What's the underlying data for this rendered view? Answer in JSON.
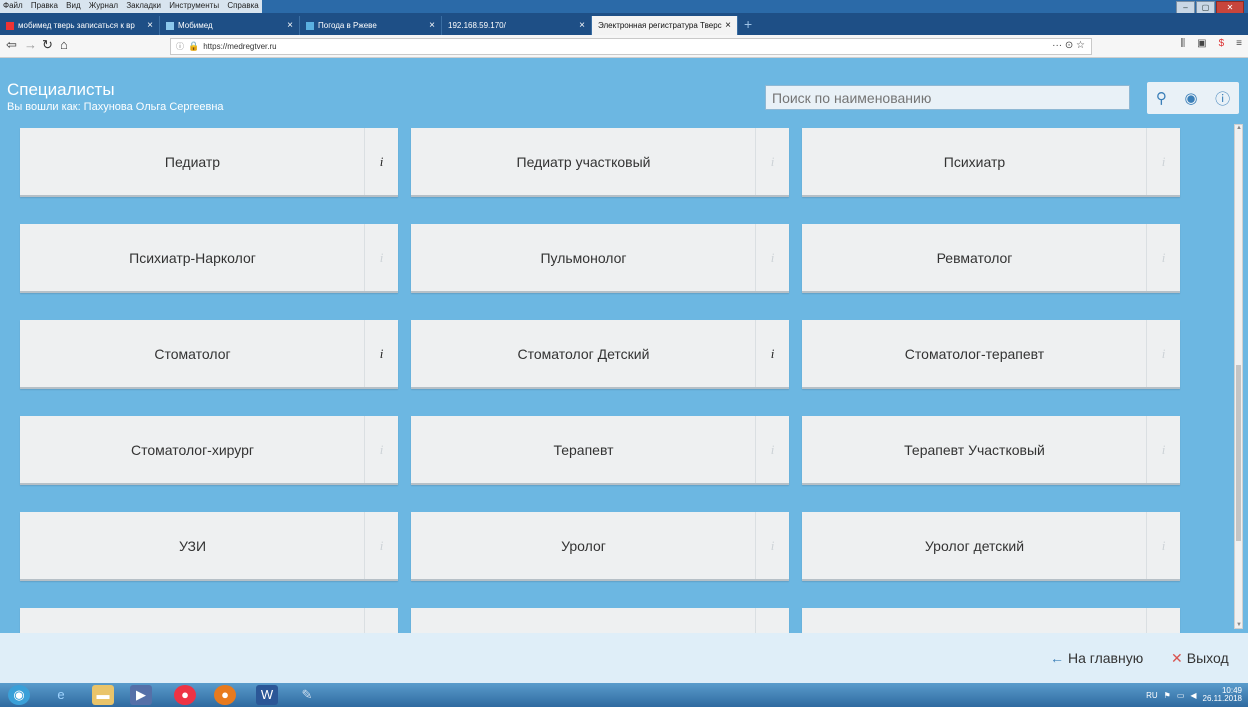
{
  "browser": {
    "menu": [
      "Файл",
      "Правка",
      "Вид",
      "Журнал",
      "Закладки",
      "Инструменты",
      "Справка"
    ],
    "tabs": [
      {
        "label": "мобимед тверь записаться к вр",
        "active": false
      },
      {
        "label": "Мобимед",
        "active": false
      },
      {
        "label": "Погода в Ржеве",
        "active": false
      },
      {
        "label": "192.168.59.170/",
        "active": false
      },
      {
        "label": "Электронная регистратура Тверс",
        "active": true
      }
    ],
    "tab_close": "×",
    "new_tab": "+",
    "url": "https://medregtver.ru",
    "url_actions": "··· ⊙ ☆",
    "nav_right": [
      "⫼",
      "▣",
      "$",
      "≡"
    ]
  },
  "header": {
    "title": "Специалисты",
    "logged_in": "Вы вошли как: Пахунова Ольга Сергеевна",
    "search_placeholder": "Поиск по наименованию"
  },
  "info_glyph": "i",
  "specialists": [
    {
      "name": "Педиатр",
      "info_active": true
    },
    {
      "name": "Педиатр участковый",
      "info_active": false
    },
    {
      "name": "Психиатр",
      "info_active": false
    },
    {
      "name": "Психиатр-Нарколог",
      "info_active": false
    },
    {
      "name": "Пульмонолог",
      "info_active": false
    },
    {
      "name": "Ревматолог",
      "info_active": false
    },
    {
      "name": "Стоматолог",
      "info_active": true
    },
    {
      "name": "Стоматолог Детский",
      "info_active": true
    },
    {
      "name": "Стоматолог-терапевт",
      "info_active": false
    },
    {
      "name": "Стоматолог-хирург",
      "info_active": false
    },
    {
      "name": "Терапевт",
      "info_active": false
    },
    {
      "name": "Терапевт Участковый",
      "info_active": false
    },
    {
      "name": "УЗИ",
      "info_active": false
    },
    {
      "name": "Уролог",
      "info_active": false
    },
    {
      "name": "Уролог детский",
      "info_active": false
    },
    {
      "name": "",
      "info_active": false
    },
    {
      "name": "",
      "info_active": false
    },
    {
      "name": "",
      "info_active": false
    }
  ],
  "footer": {
    "home": "На главную",
    "exit": "Выход"
  },
  "taskbar": {
    "lang": "RU",
    "time": "10:49",
    "date": "26.11.2018"
  },
  "colors": {
    "accent": "#6cb7e2",
    "card": "#eef0f1",
    "exit_icon": "#d9534f",
    "home_icon": "#3b7fb8"
  }
}
